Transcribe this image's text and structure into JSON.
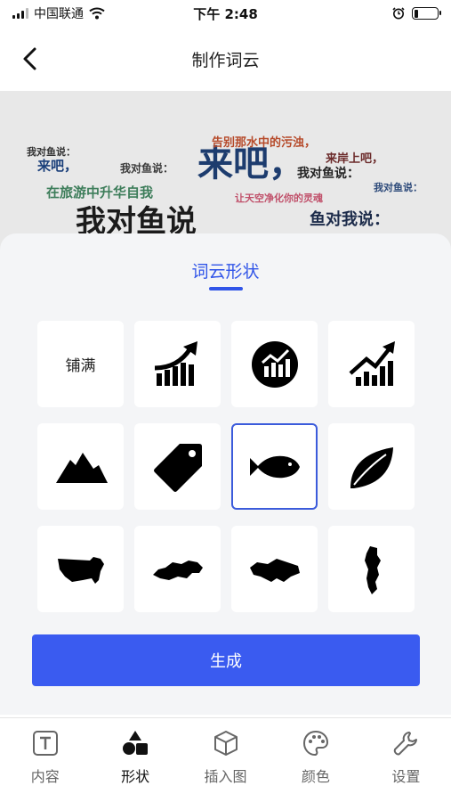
{
  "status_bar": {
    "carrier": "中国联通",
    "time": "下午 2:48"
  },
  "header": {
    "title": "制作词云"
  },
  "preview": {
    "words": [
      "我对鱼说：",
      "来吧，",
      "我对鱼说：",
      "来吧，",
      "告别那水中的污浊，",
      "来岸上吧，",
      "我对鱼说：",
      "在旅游中升华自我",
      "鱼对我说：",
      "让天空净化你的灵魂",
      "我对鱼说",
      "我对鱼说："
    ]
  },
  "shape_panel": {
    "title": "词云形状",
    "fill_label": "铺满",
    "shapes": [
      {
        "icon": "fill-text"
      },
      {
        "icon": "bar-chart-rising-arrow-icon"
      },
      {
        "icon": "circle-bar-chart-icon"
      },
      {
        "icon": "trend-up-chart-icon"
      },
      {
        "icon": "mountain-icon"
      },
      {
        "icon": "tag-icon"
      },
      {
        "icon": "fish-icon",
        "selected": true
      },
      {
        "icon": "leaf-icon"
      },
      {
        "icon": "usa-map-icon"
      },
      {
        "icon": "russia-map-icon"
      },
      {
        "icon": "ukraine-map-icon"
      },
      {
        "icon": "portugal-map-icon"
      }
    ],
    "generate_label": "生成"
  },
  "tab_bar": {
    "tabs": [
      {
        "label": "内容",
        "icon": "text-box-icon"
      },
      {
        "label": "形状",
        "icon": "shapes-icon",
        "active": true
      },
      {
        "label": "插入图",
        "icon": "cube-icon"
      },
      {
        "label": "颜色",
        "icon": "palette-icon"
      },
      {
        "label": "设置",
        "icon": "wrench-icon"
      }
    ]
  },
  "colors": {
    "accent": "#3a5bf0",
    "preview_bg": "#e8e8e8"
  }
}
